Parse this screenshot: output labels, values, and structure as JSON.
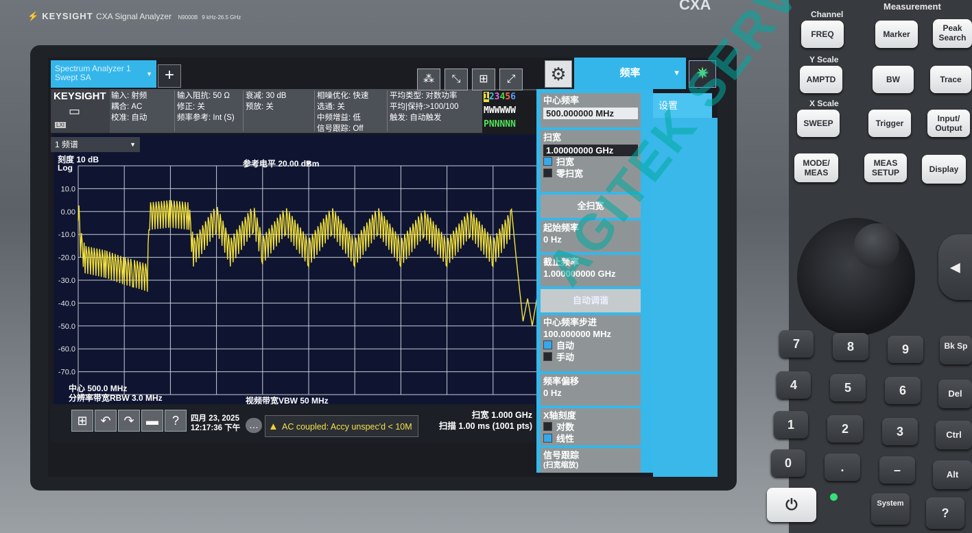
{
  "instrument": {
    "brand": "KEYSIGHT",
    "model": "CXA Signal Analyzer",
    "model_number": "N9000B",
    "range": "9 kHz-26.5 GHz",
    "series_badge": "CXA"
  },
  "screen_tabs": {
    "mode_tab_line1": "Spectrum Analyzer 1",
    "mode_tab_line2": "Swept SA",
    "add_label": "+",
    "menu_tab": "频率"
  },
  "infobar": {
    "logo": "KEYSIGHT",
    "lxi": "LXI",
    "col1": [
      "输入: 射频",
      "耦合: AC",
      "校准: 自动"
    ],
    "col2": [
      "输入阻抗: 50 Ω",
      "修正: 关",
      "频率参考: Int (S)"
    ],
    "col3": [
      "衰减: 30 dB",
      "预放: 关"
    ],
    "col4": [
      "相噪优化: 快速",
      "选通: 关",
      "中频增益: 低",
      "信号跟踪: Off"
    ],
    "col5": [
      "平均类型: 对数功率",
      "平均|保持:>100/100",
      "触发: 自动触发"
    ],
    "trace_numbers": [
      "1",
      "2",
      "3",
      "4",
      "5",
      "6"
    ],
    "trace_colors": [
      "#f0e040",
      "#36c3f0",
      "#e068e0",
      "#48d84a",
      "#ff6a4a",
      "#50a0ff"
    ],
    "trace_type_row": "MWWWWW",
    "trace_det_row": "PNNNNN"
  },
  "plot": {
    "window_select": "1 频谱",
    "scale_label": "刻度 10 dB",
    "scale_type": "Log",
    "ref_level": "参考电平 20.00 dBm",
    "y_ticks": [
      "10.0",
      "0.00",
      "-10.0",
      "-20.0",
      "-30.0",
      "-40.0",
      "-50.0",
      "-60.0",
      "-70.0"
    ],
    "center": "中心 500.0 MHz",
    "rbw": "分辨率带宽RBW 3.0 MHz",
    "vbw": "视频带宽VBW 50 MHz",
    "span": "扫宽 1.000 GHz",
    "sweep": "扫描 1.00 ms (1001 pts)",
    "trace_color": "#f4e23e",
    "grid_color": "#c8ccd8"
  },
  "chart_data": {
    "type": "line",
    "title": "参考电平 20.00 dBm",
    "xlabel": "",
    "ylabel": "刻度 10 dB",
    "xlim": [
      0,
      1000
    ],
    "ylim": [
      -80,
      20
    ],
    "grid": true,
    "series": [
      {
        "name": "",
        "x": [
          0,
          5,
          15,
          60,
          100,
          120,
          150,
          155,
          200,
          240,
          250,
          300,
          330,
          380,
          400,
          450,
          500,
          550,
          600,
          650,
          700,
          750,
          800,
          850,
          900,
          940,
          950,
          965,
          975,
          985,
          995,
          1000
        ],
        "y": [
          8,
          -8,
          -15,
          -17,
          -20,
          -21,
          -23,
          4,
          5,
          4,
          -12,
          3,
          -12,
          3,
          -11,
          2,
          -12,
          2,
          -12,
          2,
          -12,
          1,
          -12,
          1,
          -12,
          1,
          -20,
          -48,
          -38,
          -50,
          -38,
          -40
        ]
      }
    ]
  },
  "bottombar": {
    "date": "四月 23, 2025",
    "time": "12:17:36 下午",
    "warning": "AC coupled: Accy unspec'd < 10M",
    "help_label": "?"
  },
  "softkeys": {
    "center_freq_label": "中心频率",
    "center_freq_value": "500.000000 MHz",
    "span_label": "扫宽",
    "span_value": "1.00000000 GHz",
    "span_opt1": "扫宽",
    "span_opt2": "零扫宽",
    "full_span": "全扫宽",
    "start_label": "起始频率",
    "start_value": "0 Hz",
    "stop_label": "截止频率",
    "stop_value": "1.000000000 GHz",
    "auto_tune": "自动调谐",
    "step_label": "中心频率步进",
    "step_value": "100.000000 MHz",
    "step_auto": "自动",
    "step_manual": "手动",
    "offset_label": "频率偏移",
    "offset_value": "0 Hz",
    "xaxis_label": "X轴刻度",
    "xaxis_opt1": "对数",
    "xaxis_opt2": "线性",
    "track_label1": "信号跟踪",
    "track_label2": "(扫宽缩放)",
    "setup_tab": "设置"
  },
  "frontpanel": {
    "channel_label": "Channel",
    "measurement_label": "Measurement",
    "yscale_label": "Y Scale",
    "xscale_label": "X Scale",
    "keys": {
      "freq": "FREQ",
      "marker": "Marker",
      "peak": "Peak Search",
      "amptd": "AMPTD",
      "bw": "BW",
      "trace": "Trace",
      "sweep": "SWEEP",
      "trigger": "Trigger",
      "io": "Input/ Output",
      "mode": "MODE/ MEAS",
      "meas": "MEAS SETUP",
      "display": "Display",
      "n7": "7",
      "n8": "8",
      "n9": "9",
      "bksp": "Bk Sp",
      "n4": "4",
      "n5": "5",
      "n6": "6",
      "del": "Del",
      "n1": "1",
      "n2": "2",
      "n3": "3",
      "ctrl": "Ctrl",
      "n0": "0",
      "dot": ".",
      "minus": "–",
      "alt": "Alt",
      "system": "System",
      "help": "?"
    }
  },
  "watermark": "AGITEK SERVICE"
}
